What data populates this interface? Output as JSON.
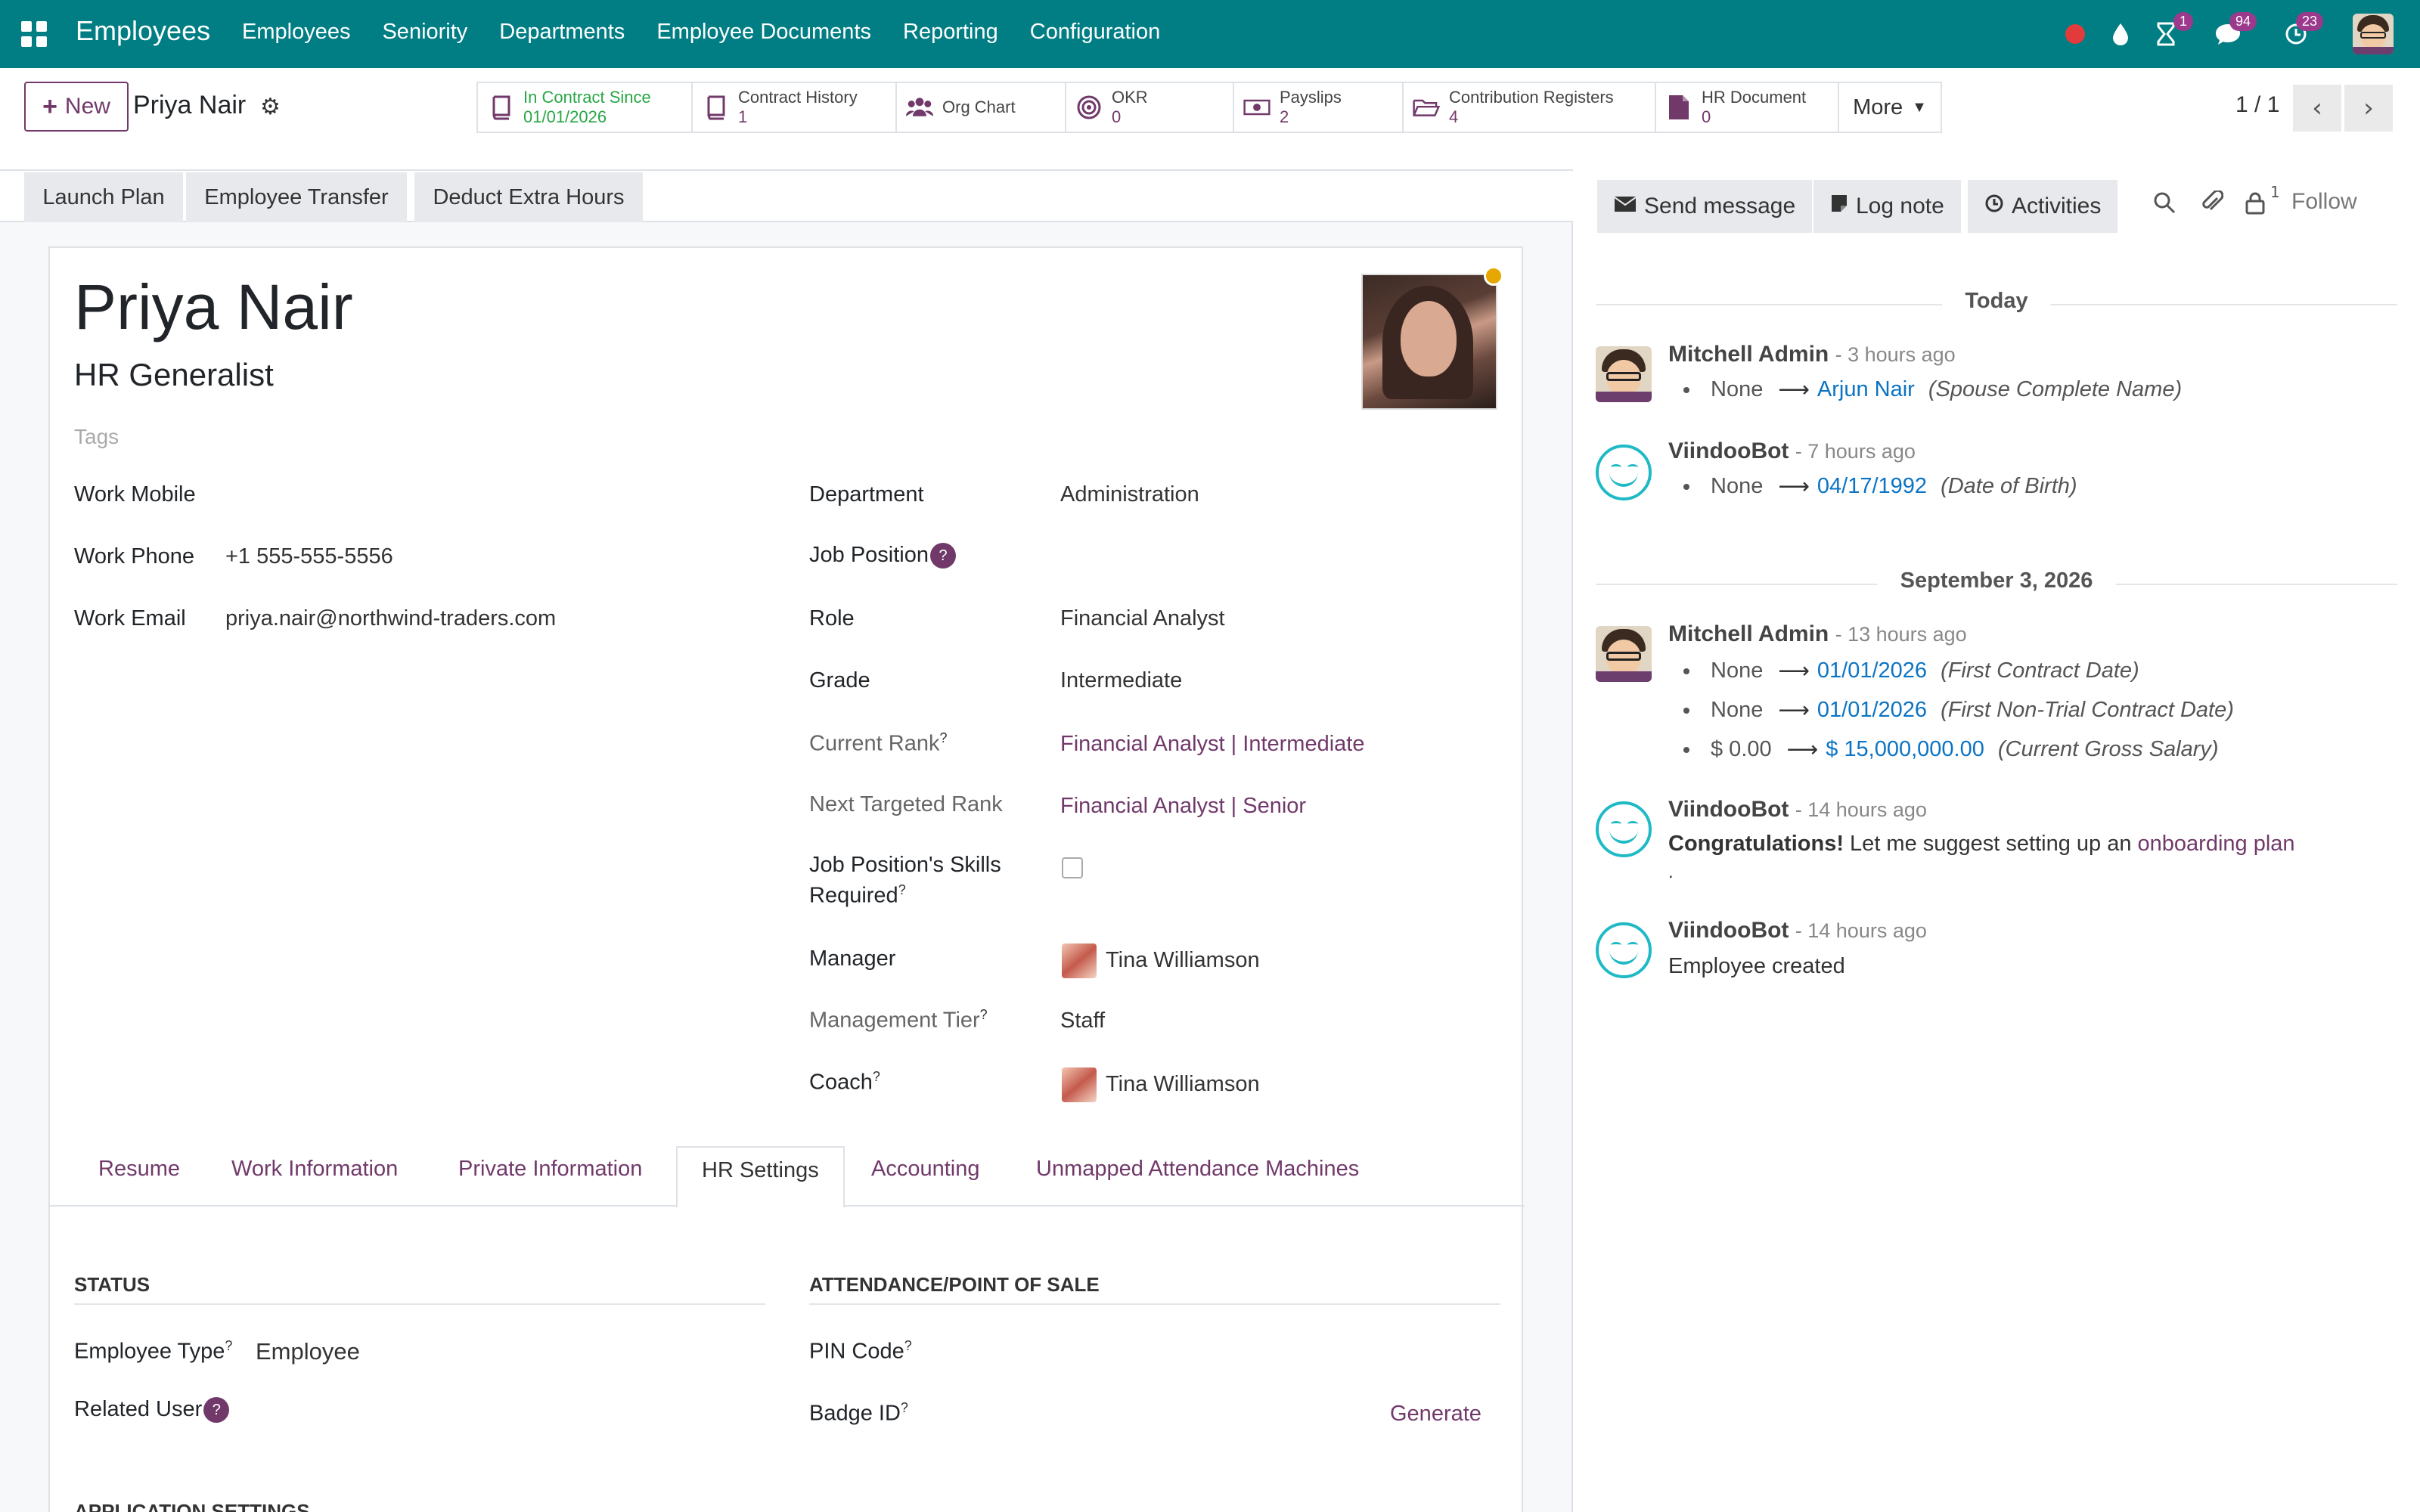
{
  "topbar": {
    "brand": "Employees",
    "menu": [
      "Employees",
      "Seniority",
      "Departments",
      "Employee Documents",
      "Reporting",
      "Configuration"
    ],
    "badges": {
      "activity": "1",
      "messages": "94",
      "clock": "23"
    },
    "colors": {
      "bar": "#017e84",
      "badge": "#9b3a8c",
      "status_dot": "#e33b3b"
    }
  },
  "control": {
    "new_label": "New",
    "breadcrumb": "Priya Nair",
    "pager": "1 / 1",
    "smart_buttons": [
      {
        "label": "In Contract Since",
        "value": "01/01/2026",
        "icon": "book-icon"
      },
      {
        "label": "Contract History",
        "value": "1",
        "icon": "book-icon"
      },
      {
        "label": "Org Chart",
        "value": "",
        "icon": "users-icon"
      },
      {
        "label": "OKR",
        "value": "0",
        "icon": "target-icon"
      },
      {
        "label": "Payslips",
        "value": "2",
        "icon": "money-icon"
      },
      {
        "label": "Contribution Registers",
        "value": "4",
        "icon": "folder-icon"
      },
      {
        "label": "HR Document",
        "value": "0",
        "icon": "file-icon"
      }
    ],
    "more_label": "More"
  },
  "header_buttons": [
    "Launch Plan",
    "Employee Transfer",
    "Deduct Extra Hours"
  ],
  "employee": {
    "name": "Priya Nair",
    "job_title": "HR Generalist",
    "tags_placeholder": "Tags"
  },
  "left_fields": [
    {
      "label": "Work Mobile",
      "value": ""
    },
    {
      "label": "Work Phone",
      "value": "+1 555-555-5556"
    },
    {
      "label": "Work Email",
      "value": "priya.nair@northwind-traders.com"
    }
  ],
  "right_fields": {
    "department": {
      "label": "Department",
      "value": "Administration"
    },
    "job_position": {
      "label": "Job Position",
      "value": ""
    },
    "role": {
      "label": "Role",
      "value": "Financial Analyst"
    },
    "grade": {
      "label": "Grade",
      "value": "Intermediate"
    },
    "current_rank": {
      "label": "Current Rank",
      "value": "Financial Analyst | Intermediate"
    },
    "next_rank": {
      "label": "Next Targeted Rank",
      "value": "Financial Analyst | Senior"
    },
    "skills_required": {
      "label_line1": "Job Position's Skills",
      "label_line2": "Required",
      "checked": false
    },
    "manager": {
      "label": "Manager",
      "value": "Tina Williamson"
    },
    "management_tier": {
      "label": "Management Tier",
      "value": "Staff"
    },
    "coach": {
      "label": "Coach",
      "value": "Tina Williamson"
    }
  },
  "tabs": [
    "Resume",
    "Work Information",
    "Private Information",
    "HR Settings",
    "Accounting",
    "Unmapped Attendance Machines"
  ],
  "active_tab": "HR Settings",
  "hr_settings": {
    "status_title": "STATUS",
    "attendance_title": "ATTENDANCE/POINT OF SALE",
    "employee_type": {
      "label": "Employee Type",
      "value": "Employee"
    },
    "related_user": {
      "label": "Related User"
    },
    "pin_code": {
      "label": "PIN Code"
    },
    "badge_id": {
      "label": "Badge ID",
      "action": "Generate"
    },
    "application_settings": "APPLICATION SETTINGS"
  },
  "chatter": {
    "send_message": "Send message",
    "log_note": "Log note",
    "activities": "Activities",
    "follower_count": "1",
    "follow": "Follow",
    "groups": [
      {
        "date": "Today"
      },
      {
        "date": "September 3, 2026"
      }
    ],
    "messages": [
      {
        "author": "Mitchell Admin",
        "ago": "- 3 hours ago",
        "tracking": [
          {
            "old": "None",
            "new": "Arjun Nair",
            "field": "(Spouse Complete Name)"
          }
        ]
      },
      {
        "author": "ViindooBot",
        "ago": "- 7 hours ago",
        "tracking": [
          {
            "old": "None",
            "new": "04/17/1992",
            "field": "(Date of Birth)"
          }
        ]
      },
      {
        "author": "Mitchell Admin",
        "ago": "- 13 hours ago",
        "tracking": [
          {
            "old": "None",
            "new": "01/01/2026",
            "field": "(First Contract Date)"
          },
          {
            "old": "None",
            "new": "01/01/2026",
            "field": "(First Non-Trial Contract Date)"
          },
          {
            "old": "$ 0.00",
            "new": "$ 15,000,000.00",
            "field": "(Current Gross Salary)"
          }
        ]
      },
      {
        "author": "ViindooBot",
        "ago": "- 14 hours ago",
        "body_bold": "Congratulations!",
        "body_text": " Let me suggest setting up an ",
        "body_link": "onboarding plan",
        "body_tail": "."
      },
      {
        "author": "ViindooBot",
        "ago": "- 14 hours ago",
        "body": "Employee created"
      }
    ]
  }
}
